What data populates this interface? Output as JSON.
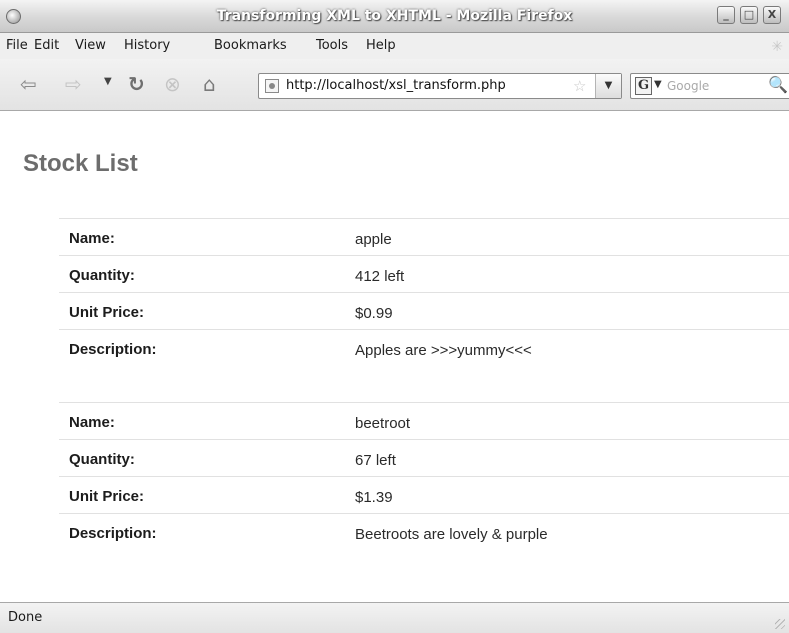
{
  "window": {
    "title": "Transforming XML to XHTML - Mozilla Firefox",
    "buttons": {
      "minimize": "_",
      "maximize": "□",
      "close": "X"
    }
  },
  "menu": [
    "File",
    "Edit",
    "View",
    "History",
    "Bookmarks",
    "Tools",
    "Help"
  ],
  "navigation": {
    "icons": [
      "back-arrow",
      "forward-arrow",
      "history-dropdown",
      "reload",
      "stop",
      "home"
    ],
    "url": "http://localhost/xsl_transform.php",
    "search": {
      "engine_glyph": "G",
      "placeholder": "Google"
    }
  },
  "page": {
    "title": "Stock List",
    "items": [
      {
        "rows": [
          {
            "label": "Name:",
            "value": "apple"
          },
          {
            "label": "Quantity:",
            "value": "412 left"
          },
          {
            "label": "Unit Price:",
            "value": "$0.99"
          },
          {
            "label": "Description:",
            "value": "Apples are >>>yummy<<<"
          }
        ]
      },
      {
        "rows": [
          {
            "label": "Name:",
            "value": "beetroot"
          },
          {
            "label": "Quantity:",
            "value": "67 left"
          },
          {
            "label": "Unit Price:",
            "value": "$1.39"
          },
          {
            "label": "Description:",
            "value": "Beetroots are lovely & purple"
          }
        ]
      }
    ]
  },
  "status": {
    "text": "Done"
  }
}
